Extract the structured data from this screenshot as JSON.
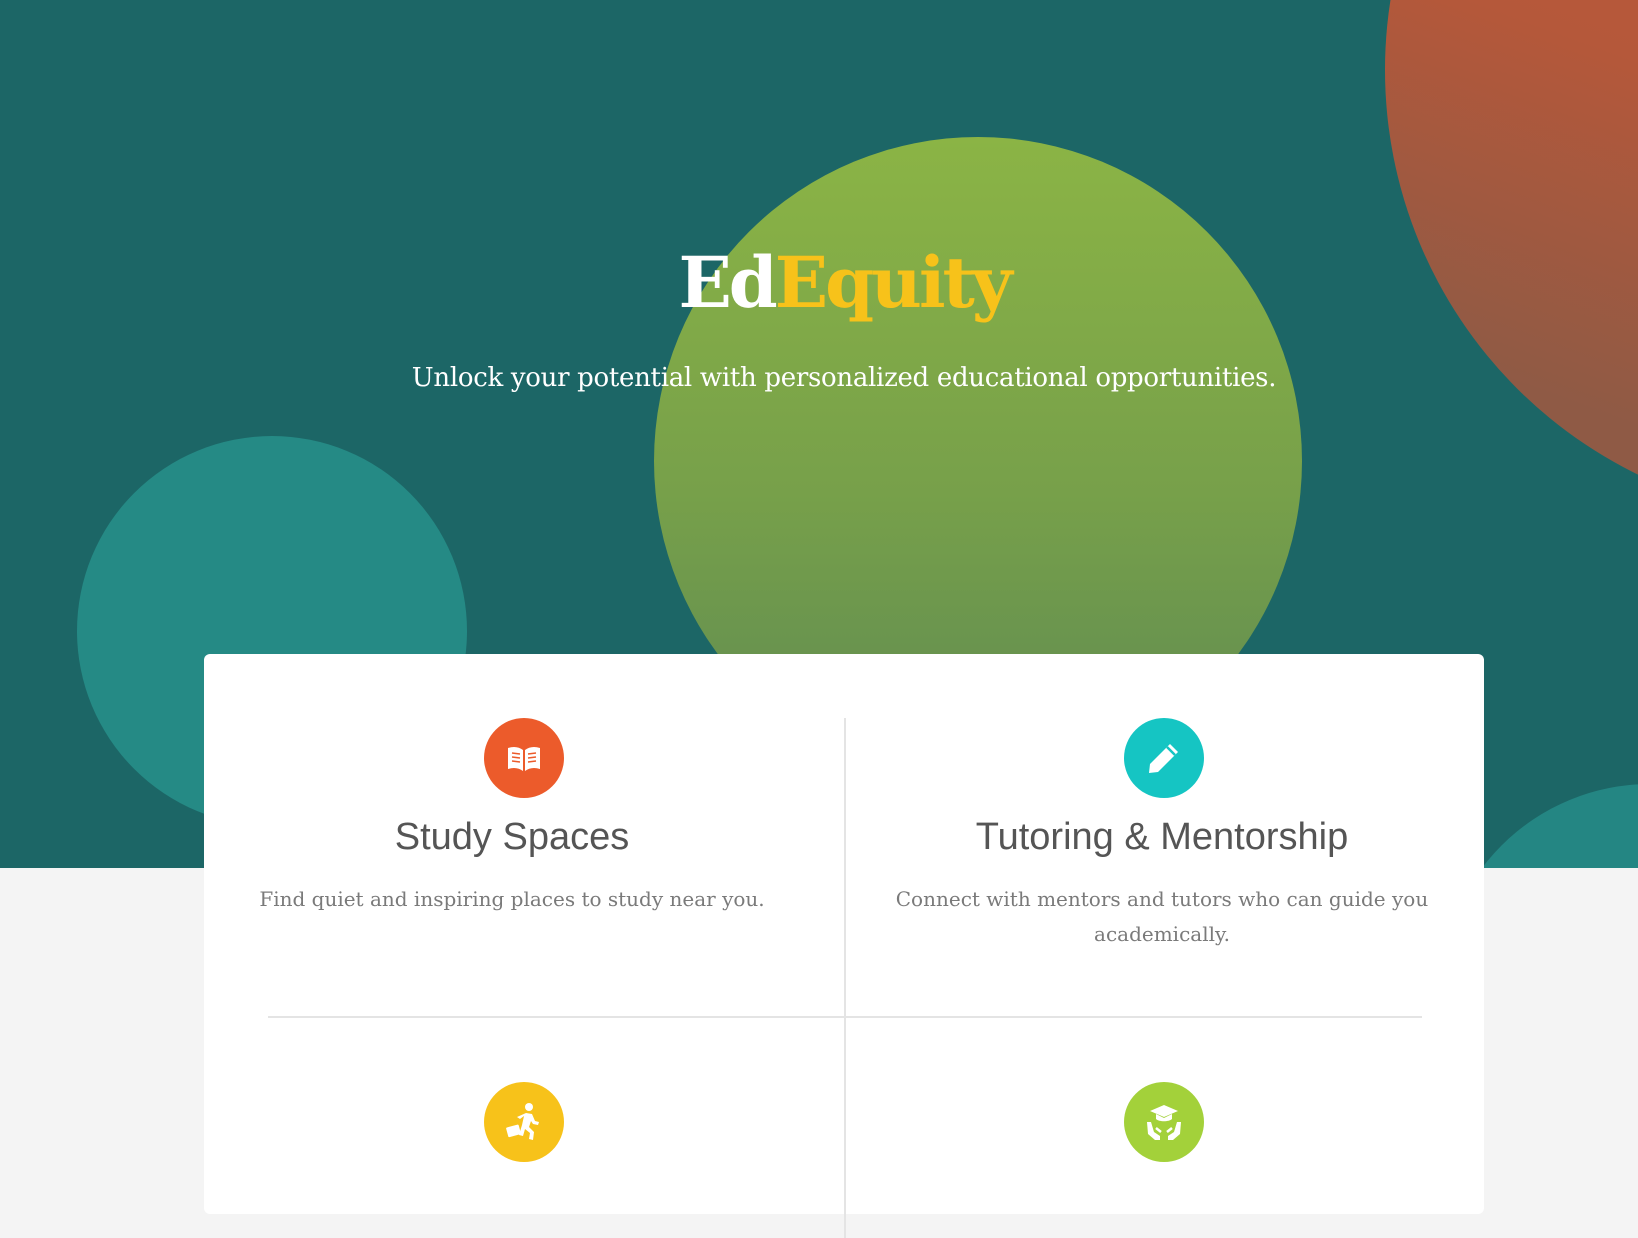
{
  "hero": {
    "brand_part1": "Ed",
    "brand_part2": "Equity",
    "tagline": "Unlock your potential with personalized educational opportunities."
  },
  "features": [
    {
      "title": "Study Spaces",
      "description": "Find quiet and inspiring places to study near you.",
      "icon": "open-book-icon",
      "color": "#ec5b2b"
    },
    {
      "title": "Tutoring & Mentorship",
      "description": "Connect with mentors and tutors who can guide you academically.",
      "icon": "pencil-icon",
      "color": "#15c5c3"
    },
    {
      "title": "",
      "description": "",
      "icon": "walking-briefcase-icon",
      "color": "#f7c21a"
    },
    {
      "title": "",
      "description": "",
      "icon": "graduation-cap-hands-icon",
      "color": "#a3d13a"
    }
  ],
  "colors": {
    "hero_background": "#1c6666",
    "brand_white": "#ffffff",
    "brand_yellow": "#f7c21a",
    "page_background": "#f4f4f4"
  }
}
